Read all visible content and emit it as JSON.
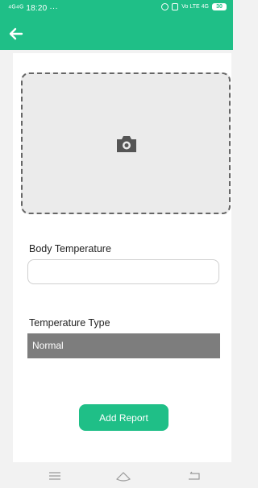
{
  "status_bar": {
    "signal_text": "⁴ᴳ⁴ᴳ",
    "time": "18:20",
    "dots": "···",
    "network": "Vo LTE 4G",
    "battery": "30"
  },
  "app_bar": {
    "back_icon": "arrow-left-icon"
  },
  "form": {
    "photo_icon": "camera-icon",
    "body_temperature_label": "Body Temperature",
    "body_temperature_value": "",
    "temperature_type_label": "Temperature Type",
    "temperature_type_value": "Normal",
    "submit_label": "Add Report"
  },
  "nav_bar": {
    "icons": [
      "menu-icon",
      "home-icon",
      "back-icon"
    ]
  },
  "colors": {
    "brand": "#1fbf87",
    "select_bg": "#7d7d7d",
    "background": "#f2f2f2"
  }
}
